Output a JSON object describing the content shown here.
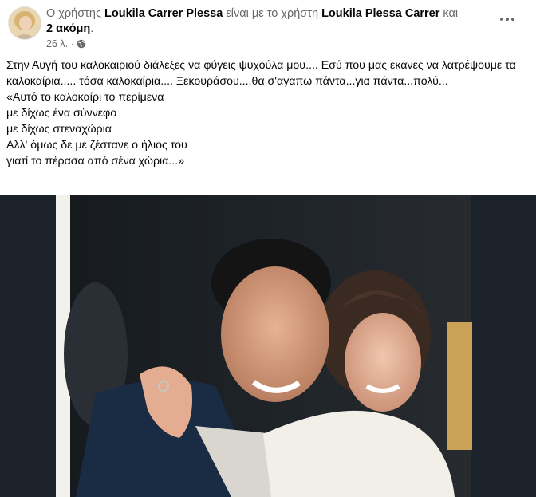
{
  "post": {
    "header": {
      "prefix": "Ο χρήστης ",
      "author": "Loukila Carrer Plessa",
      "with_text": " είναι με το χρήστη ",
      "tagged": "Loukila Plessa Carrer",
      "and_text": " και ",
      "others": "2 ακόμη",
      "suffix": "."
    },
    "meta": {
      "time": "26 λ.",
      "separator": "·",
      "privacy_icon": "globe-icon"
    },
    "more_icon": "ellipsis-icon",
    "text": {
      "paragraph": "Στην Αυγή του καλοκαιριού διάλεξες να φύγεις ψυχούλα μου.... Εσύ που μας εκανες να λατρέψουμε τα καλοκαίρια..... τόσα καλοκαίρια.... Ξεκουράσου....θα σ'αγαπω πάντα...για πάντα...πολύ...",
      "poem": [
        "«Αυτό το καλοκαίρι το περίμενα",
        "με δίχως ένα σύννεφο",
        "με δίχως στεναχώρια",
        "Αλλ' όμως δε με ζέστανε ο ήλιος του",
        "γιατί το πέρασα από σένα χώρια...»"
      ]
    },
    "photo": {
      "description_icon": "photo-couple"
    }
  }
}
